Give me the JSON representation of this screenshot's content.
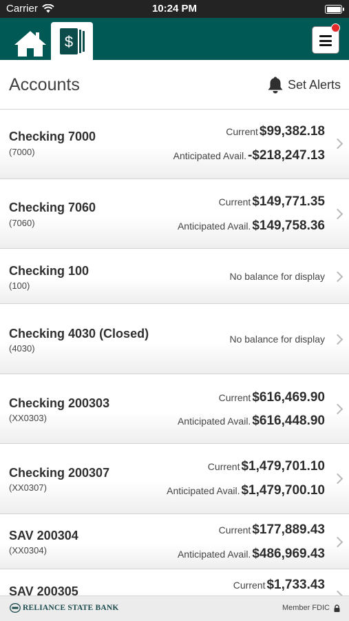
{
  "status_bar": {
    "carrier": "Carrier",
    "time": "10:24 PM"
  },
  "header": {
    "title": "Accounts",
    "set_alerts_label": "Set Alerts"
  },
  "accounts": [
    {
      "name": "Checking 7000",
      "number": "(7000)",
      "current_label": "Current",
      "current": "$99,382.18",
      "anticipated_label": "Anticipated Avail.",
      "anticipated": "-$218,247.13"
    },
    {
      "name": "Checking 7060",
      "number": "(7060)",
      "current_label": "Current",
      "current": "$149,771.35",
      "anticipated_label": "Anticipated Avail.",
      "anticipated": "$149,758.36"
    },
    {
      "name": "Checking 100",
      "number": "(100)",
      "no_balance": "No balance for display"
    },
    {
      "name": "Checking 4030 (Closed)",
      "number": "(4030)",
      "no_balance": "No balance for display"
    },
    {
      "name": "Checking 200303",
      "number": "(XX0303)",
      "current_label": "Current",
      "current": "$616,469.90",
      "anticipated_label": "Anticipated Avail.",
      "anticipated": "$616,448.90"
    },
    {
      "name": "Checking 200307",
      "number": "(XX0307)",
      "current_label": "Current",
      "current": "$1,479,701.10",
      "anticipated_label": "Anticipated Avail.",
      "anticipated": "$1,479,700.10"
    },
    {
      "name": "SAV 200304",
      "number": "(XX0304)",
      "current_label": "Current",
      "current": "$177,889.43",
      "anticipated_label": "Anticipated Avail.",
      "anticipated": "$486,969.43"
    },
    {
      "name": "SAV 200305",
      "current_label": "Current",
      "current": "$1,733.43"
    }
  ],
  "footer": {
    "bank_name": "RELIANCE STATE BANK",
    "member_fdic": "Member FDIC"
  },
  "colors": {
    "nav_bar": "#005955",
    "status_bar": "#232323",
    "notification": "#e32b2b"
  }
}
